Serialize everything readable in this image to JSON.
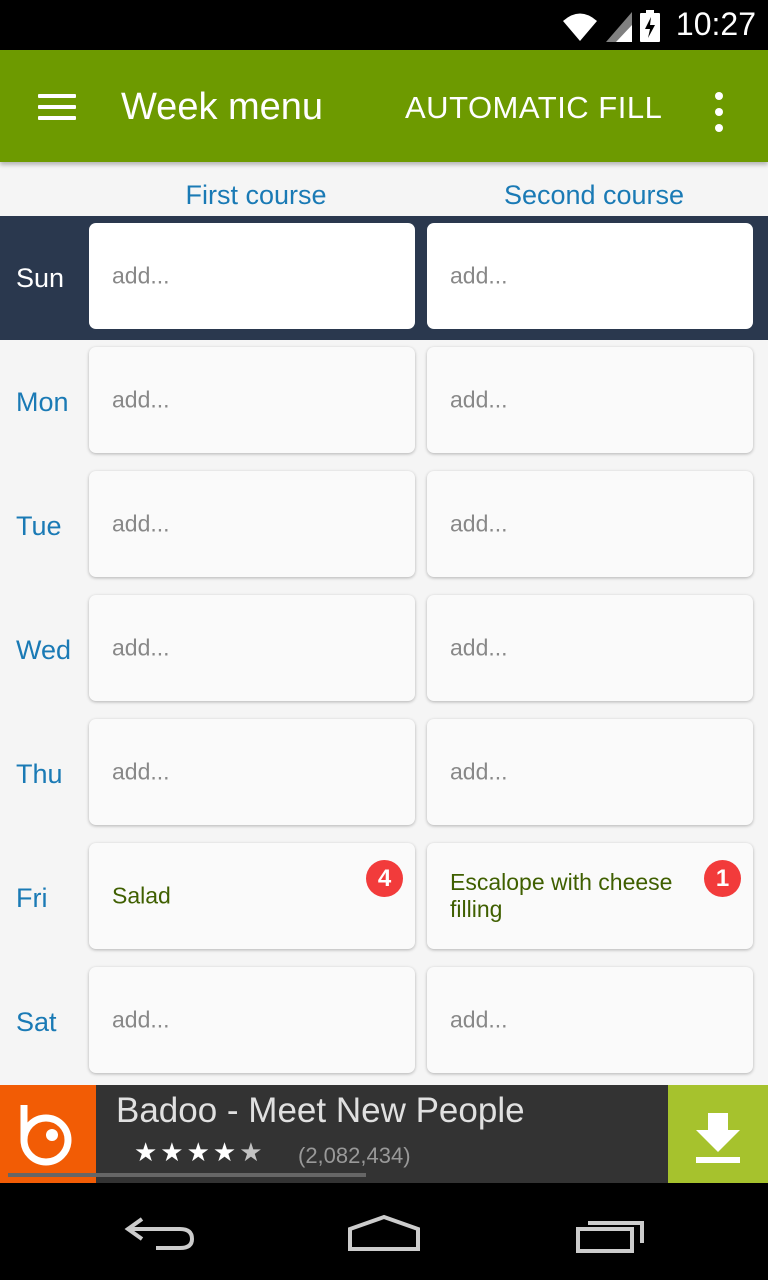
{
  "status_bar": {
    "time": "10:27"
  },
  "app_bar": {
    "title": "Week menu",
    "action": "AUTOMATIC FILL"
  },
  "columns": {
    "first": "First course",
    "second": "Second course"
  },
  "days": [
    {
      "label": "Sun",
      "first": "add...",
      "second": "add..."
    },
    {
      "label": "Mon",
      "first": "add...",
      "second": "add..."
    },
    {
      "label": "Tue",
      "first": "add...",
      "second": "add..."
    },
    {
      "label": "Wed",
      "first": "add...",
      "second": "add..."
    },
    {
      "label": "Thu",
      "first": "add...",
      "second": "add..."
    },
    {
      "label": "Fri",
      "first": "Salad",
      "first_badge": "4",
      "second": "Escalope with cheese filling",
      "second_badge": "1"
    },
    {
      "label": "Sat",
      "first": "add...",
      "second": "add..."
    }
  ],
  "selected_day": "Sun",
  "ad": {
    "title": "Badoo - Meet New People",
    "rating_stars": 4.5,
    "rating_count": "(2,082,434)"
  },
  "colors": {
    "app_bar": "#6d9a00",
    "selected_row": "#2a384e",
    "link": "#1a7ab5",
    "badge": "#f23b3b",
    "filled_text": "#3f5f00"
  }
}
